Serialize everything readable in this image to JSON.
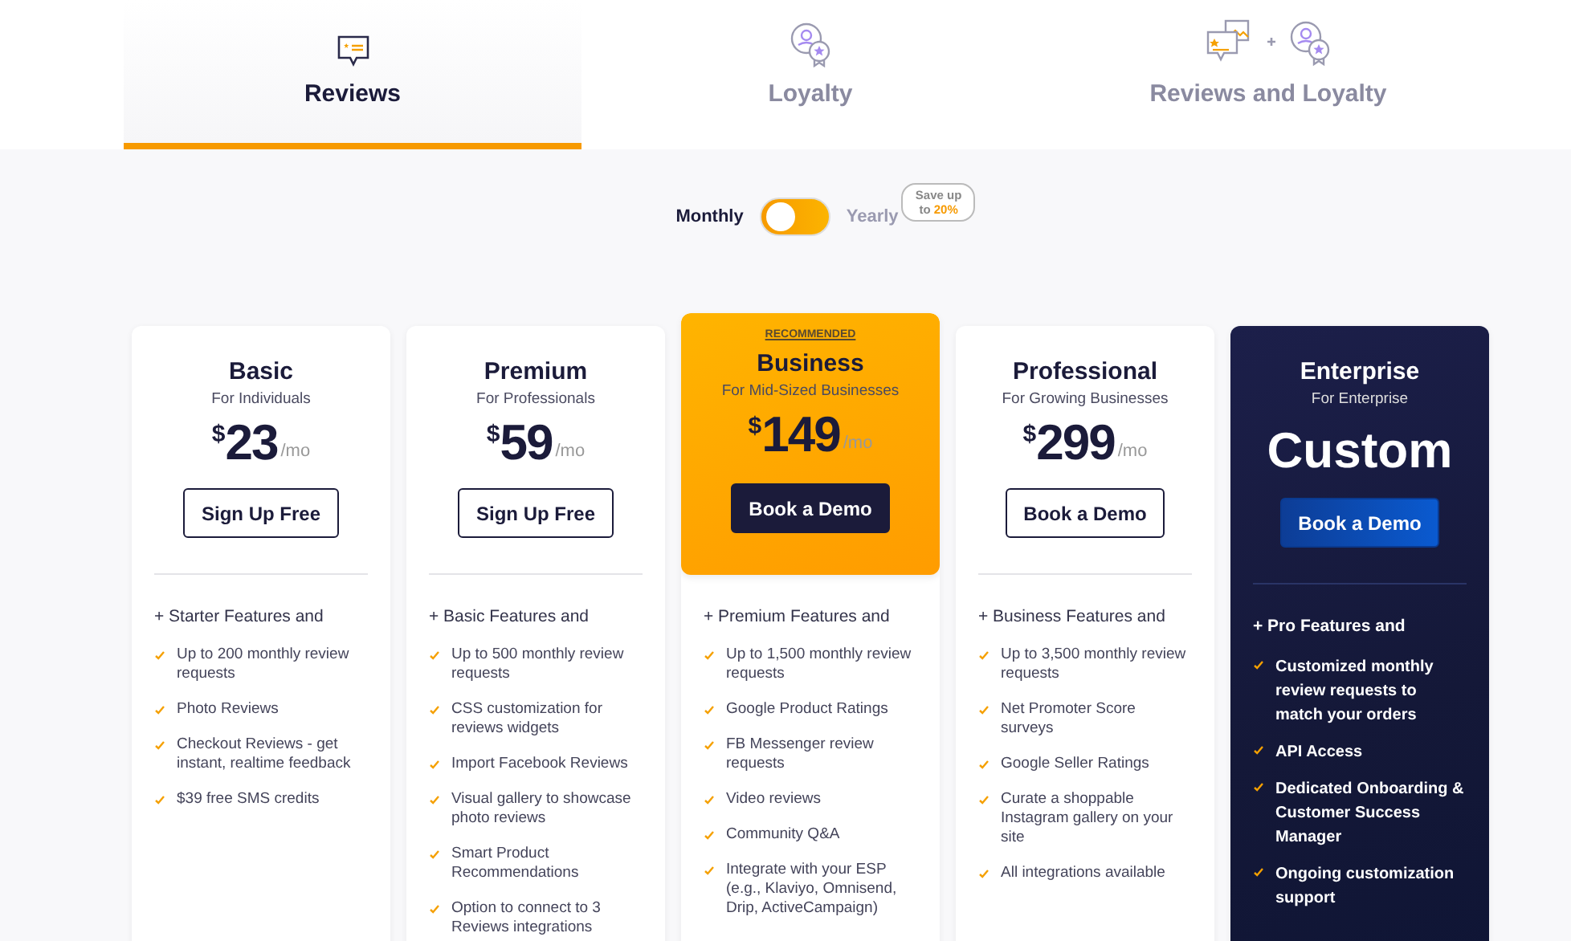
{
  "tabs": [
    {
      "label": "Reviews",
      "kind": "reviews",
      "selected": true
    },
    {
      "label": "Loyalty",
      "kind": "loyalty",
      "selected": false
    },
    {
      "label": "Reviews and Loyalty",
      "kind": "both",
      "selected": false
    }
  ],
  "billing": {
    "monthly_label": "Monthly",
    "yearly_label": "Yearly",
    "yearly": false,
    "save_badge": "Save up to **20%**"
  },
  "plans": [
    {
      "kind": "plain",
      "name": "Basic",
      "audience": "For Individuals",
      "currency": "$",
      "price": "23",
      "period": "/mo",
      "button": "Sign Up Free",
      "features_heading": "+ Starter Features and",
      "features": [
        "Up to 200 monthly review requests",
        "Photo Reviews",
        "Checkout Reviews - get instant, realtime feedback",
        "$39 free SMS credits"
      ]
    },
    {
      "kind": "plain",
      "name": "Premium",
      "audience": "For Professionals",
      "currency": "$",
      "price": "59",
      "period": "/mo",
      "button": "Sign Up Free",
      "features_heading": "+ Basic Features and",
      "features": [
        "Up to 500 monthly review requests",
        "CSS customization for reviews widgets",
        "Import Facebook Reviews",
        "Visual gallery to showcase photo reviews",
        "Smart Product Recommendations",
        "Option to connect to 3 Reviews integrations"
      ]
    },
    {
      "kind": "featured",
      "badge": "RECOMMENDED",
      "name": "Business",
      "audience": "For Mid-Sized Businesses",
      "currency": "$",
      "price": "149",
      "period": "/mo",
      "button": "Book a Demo",
      "features_heading": "+ Premium Features and",
      "features": [
        "Up to 1,500 monthly review requests",
        "Google Product Ratings",
        "FB Messenger review requests",
        "Video reviews",
        "Community Q&A",
        "Integrate with your ESP (e.g., Klaviyo, Omnisend, Drip, ActiveCampaign)"
      ]
    },
    {
      "kind": "plain",
      "name": "Professional",
      "audience": "For Growing Businesses",
      "currency": "$",
      "price": "299",
      "period": "/mo",
      "button": "Book a Demo",
      "features_heading": "+ Business Features and",
      "features": [
        "Up to 3,500 monthly review requests",
        "Net Promoter Score surveys",
        "Google Seller Ratings",
        "Curate a shoppable Instagram gallery on your site",
        "All integrations available"
      ]
    },
    {
      "kind": "dark",
      "name": "Enterprise",
      "audience": "For Enterprise",
      "price": "Custom",
      "button": "Book a Demo",
      "features_heading": "+ Pro Features and",
      "features": [
        "Customized monthly review requests to match your orders",
        "API Access",
        "Dedicated Onboarding & Customer Success Manager",
        "Ongoing customization support"
      ]
    }
  ]
}
